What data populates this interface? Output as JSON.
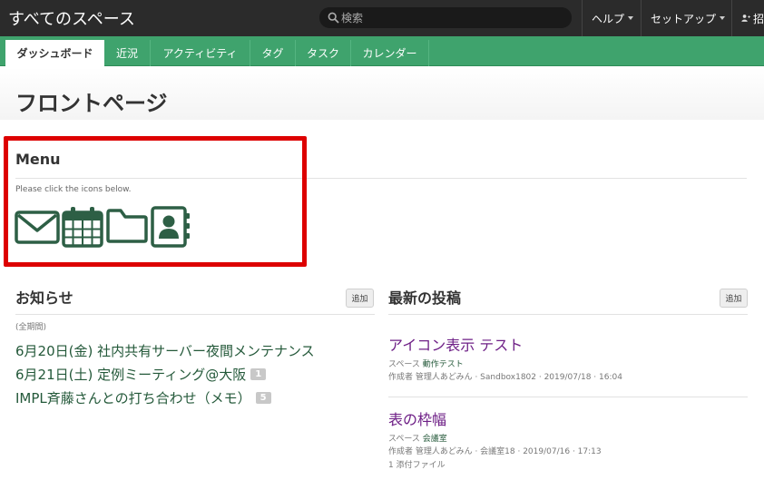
{
  "header": {
    "space_title": "すべてのスペース",
    "search_placeholder": "検索",
    "nav_help": "ヘルプ",
    "nav_setup": "セットアップ",
    "nav_invite": "招"
  },
  "tabs": [
    {
      "label": "ダッシュボード",
      "active": true
    },
    {
      "label": "近況",
      "active": false
    },
    {
      "label": "アクティビティ",
      "active": false
    },
    {
      "label": "タグ",
      "active": false
    },
    {
      "label": "タスク",
      "active": false
    },
    {
      "label": "カレンダー",
      "active": false
    }
  ],
  "page_title": "フロントページ",
  "menu": {
    "heading": "Menu",
    "description": "Please click the icons below.",
    "icons": [
      "mail-icon",
      "calendar-icon",
      "folder-icon",
      "address-book-icon"
    ],
    "icon_color": "#2d5f45",
    "highlight_color": "#dd0000"
  },
  "notices": {
    "heading": "お知らせ",
    "add_label": "追加",
    "period": "(全期間)",
    "items": [
      {
        "text": "6月20日(金) 社内共有サーバー夜間メンテナンス",
        "count": ""
      },
      {
        "text": "6月21日(土) 定例ミーティング@大阪",
        "count": "1"
      },
      {
        "text": "IMPL斉藤さんとの打ち合わせ（メモ）",
        "count": "5"
      }
    ]
  },
  "posts": {
    "heading": "最新の投稿",
    "add_label": "追加",
    "items": [
      {
        "title": "アイコン表示 テスト",
        "space_prefix": "スペース",
        "space_name": "動作テスト",
        "author_line": "作成者 管理人あどみん · Sandbox1802 · 2019/07/18 · 16:04",
        "extra": ""
      },
      {
        "title": "表の枠幅",
        "space_prefix": "スペース",
        "space_name": "会議室",
        "author_line": "作成者 管理人あどみん · 会議室18 · 2019/07/16 · 17:13",
        "extra": "1 添付ファイル"
      }
    ]
  }
}
